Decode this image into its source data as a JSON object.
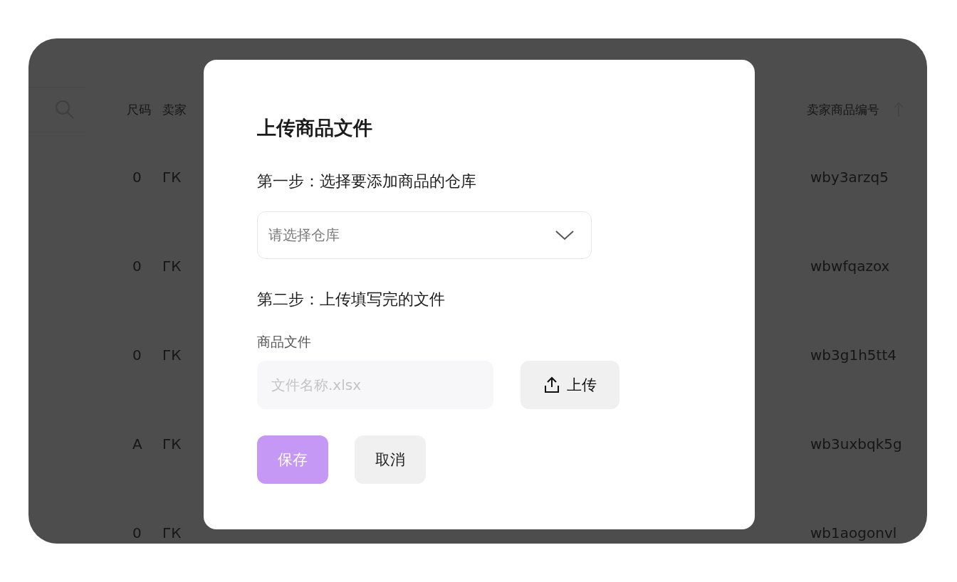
{
  "table": {
    "columns": [
      {
        "label": "尺码"
      },
      {
        "label": "卖家"
      },
      {
        "label": "卖家商品编号",
        "sortable": true
      }
    ],
    "rows": [
      {
        "size": "0",
        "seller": "ГК",
        "code": "wby3arzq5"
      },
      {
        "size": "0",
        "seller": "ГК",
        "code": "wbwfqazox"
      },
      {
        "size": "0",
        "seller": "ГК",
        "code": "wb3g1h5tt4"
      },
      {
        "size": "A",
        "seller": "ГК",
        "code": "wb3uxbqk5g"
      },
      {
        "size": "0",
        "seller": "ГК",
        "code": "wb1aogonvl"
      }
    ]
  },
  "dialog": {
    "title": "上传商品文件",
    "step1": "第一步：选择要添加商品的仓库",
    "warehouse_select": {
      "placeholder": "请选择仓库"
    },
    "step2": "第二步：上传填写完的文件",
    "file_label": "商品文件",
    "file_input": {
      "placeholder": "文件名称.xlsx"
    },
    "upload_button": "上传",
    "buttons": [
      {
        "kind": "primary",
        "label": "保存",
        "disabled": true
      },
      {
        "kind": "secondary",
        "label": "取消",
        "disabled": false
      }
    ]
  }
}
